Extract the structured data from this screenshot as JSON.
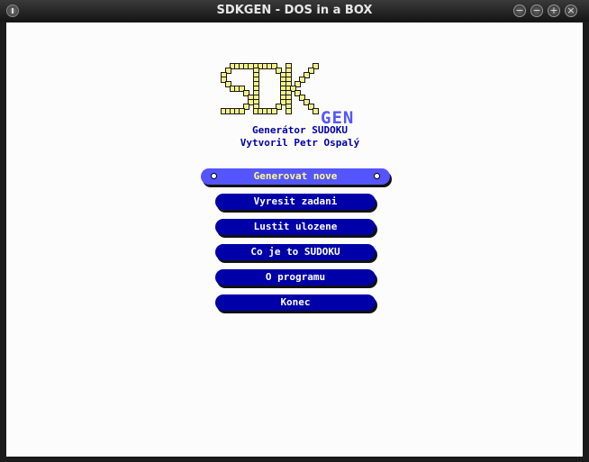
{
  "window": {
    "title": "SDKGEN - DOS in a BOX"
  },
  "logo": {
    "letters": "SDK",
    "suffix": "GEN",
    "subtitle": "Generátor SUDOKU",
    "author": "Vytvoril Petr Ospalý"
  },
  "menu": {
    "selected_index": 0,
    "items": [
      {
        "label": "Generovat nove"
      },
      {
        "label": "Vyresit zadani"
      },
      {
        "label": "Lustit ulozene"
      },
      {
        "label": "Co je to SUDOKU"
      },
      {
        "label": "O programu"
      },
      {
        "label": "Konec"
      }
    ]
  },
  "colors": {
    "button": "#0000a8",
    "button_selected": "#5555ff",
    "selected_text": "#ffff80",
    "logo_blocks": "#f3f18a",
    "text_blue": "#0000a8"
  }
}
